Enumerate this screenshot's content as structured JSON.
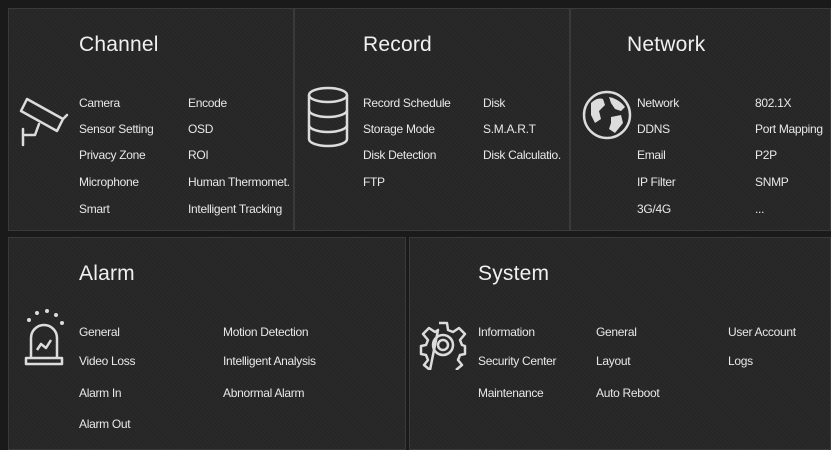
{
  "channel": {
    "title": "Channel",
    "items": [
      "Camera",
      "Encode",
      "Sensor Setting",
      "OSD",
      "Privacy Zone",
      "ROI",
      "Microphone",
      "Human Thermomet.",
      "Smart",
      "Intelligent Tracking"
    ]
  },
  "record": {
    "title": "Record",
    "items": [
      "Record Schedule",
      "Disk",
      "Storage Mode",
      "S.M.A.R.T",
      "Disk Detection",
      "Disk Calculatio.",
      "FTP"
    ]
  },
  "network": {
    "title": "Network",
    "items": [
      "Network",
      "802.1X",
      "DDNS",
      "Port Mapping",
      "Email",
      "P2P",
      "IP Filter",
      "SNMP",
      "3G/4G",
      "..."
    ]
  },
  "alarm": {
    "title": "Alarm",
    "items": [
      "General",
      "Motion Detection",
      "Video Loss",
      "Intelligent Analysis",
      "Alarm In",
      "Abnormal Alarm",
      "Alarm Out"
    ]
  },
  "system": {
    "title": "System",
    "items": [
      "Information",
      "General",
      "User Account",
      "Security Center",
      "Layout",
      "Logs",
      "Maintenance",
      "Auto Reboot"
    ]
  },
  "icons": {
    "channel": "camera-icon",
    "record": "database-icon",
    "network": "globe-icon",
    "alarm": "alarm-siren-icon",
    "system": "gear-icon"
  },
  "colors": {
    "panel_bg": "#262626",
    "text": "#e8e8e8",
    "icon": "#dcdcdc"
  }
}
